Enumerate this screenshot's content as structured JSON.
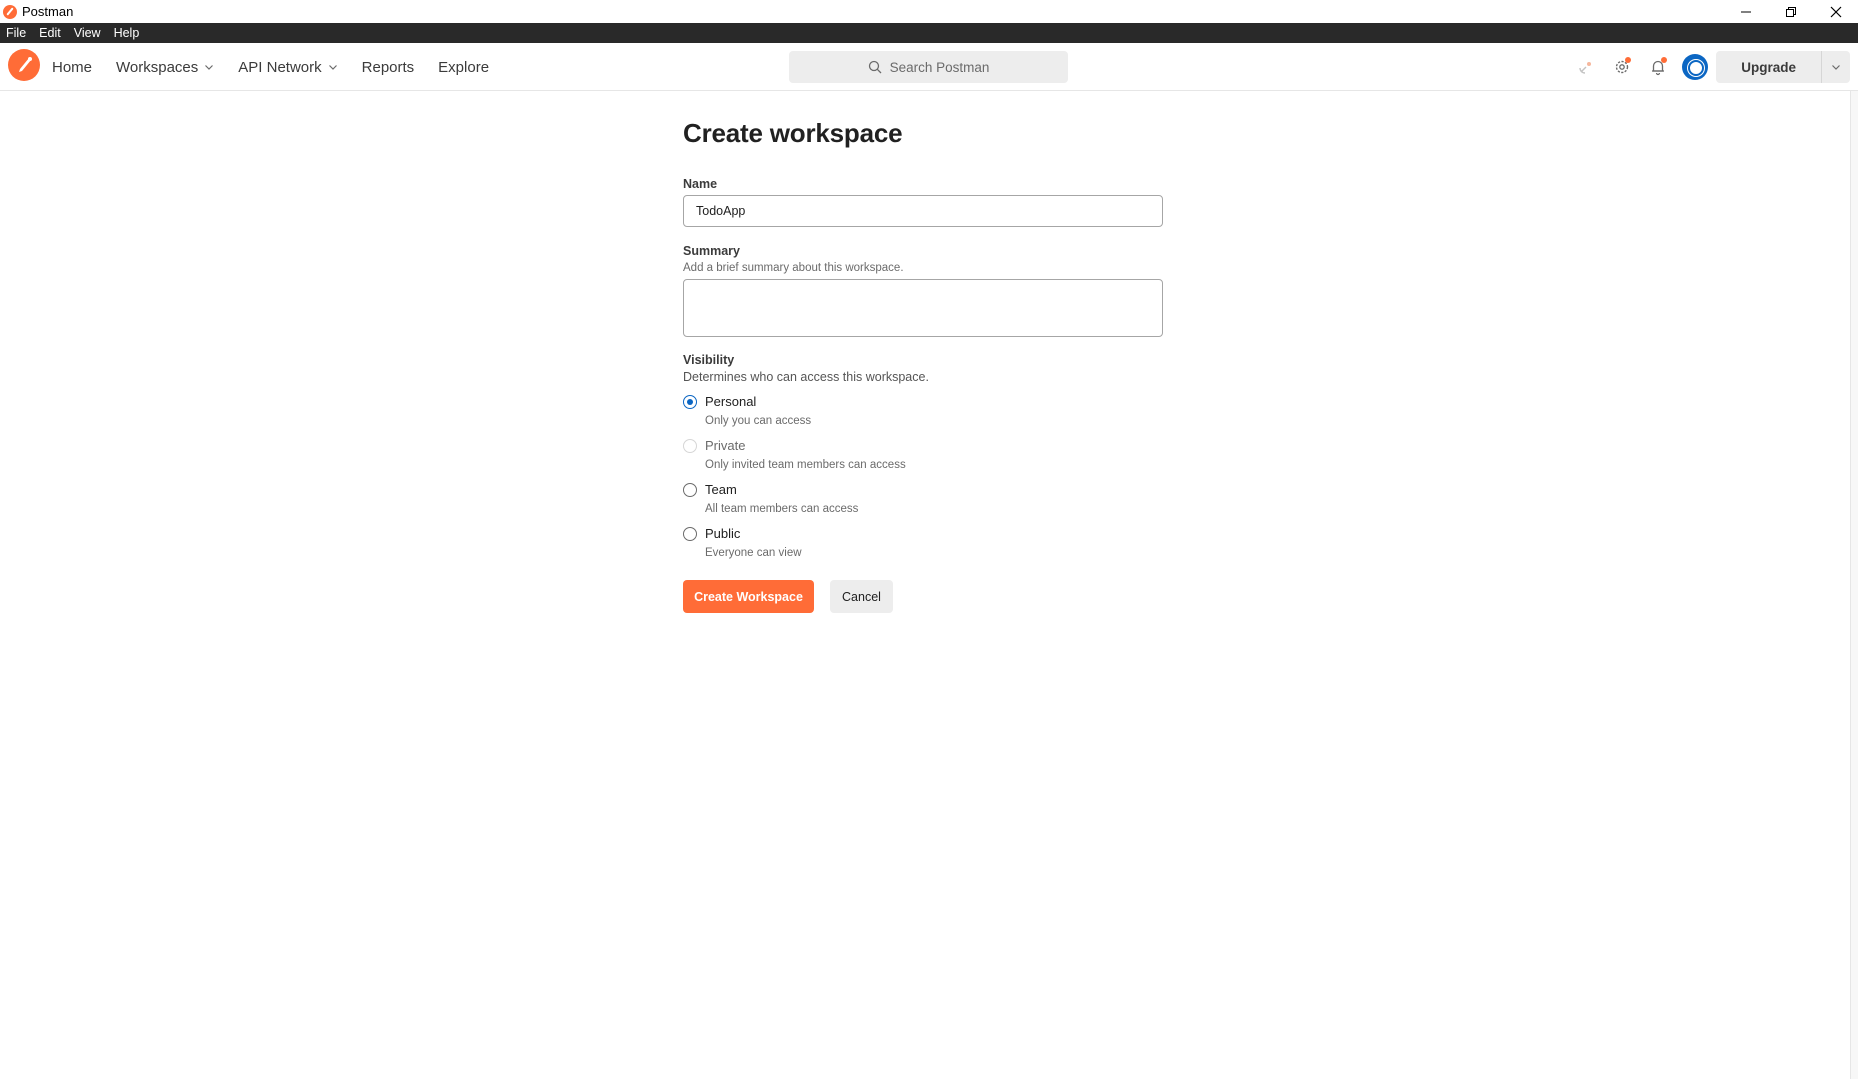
{
  "window": {
    "title": "Postman"
  },
  "menubar": {
    "items": [
      "File",
      "Edit",
      "View",
      "Help"
    ]
  },
  "header": {
    "nav": {
      "home": "Home",
      "workspaces": "Workspaces",
      "api_network": "API Network",
      "reports": "Reports",
      "explore": "Explore"
    },
    "search_placeholder": "Search Postman",
    "upgrade_label": "Upgrade"
  },
  "form": {
    "title": "Create workspace",
    "name_label": "Name",
    "name_value": "TodoApp",
    "summary_label": "Summary",
    "summary_help": "Add a brief summary about this workspace.",
    "summary_value": "",
    "visibility_label": "Visibility",
    "visibility_help": "Determines who can access this workspace.",
    "visibility_options": [
      {
        "title": "Personal",
        "desc": "Only you can access",
        "state": "checked"
      },
      {
        "title": "Private",
        "desc": "Only invited team members can access",
        "state": "disabled"
      },
      {
        "title": "Team",
        "desc": "All team members can access",
        "state": "unchecked"
      },
      {
        "title": "Public",
        "desc": "Everyone can view",
        "state": "unchecked"
      }
    ],
    "create_button": "Create Workspace",
    "cancel_button": "Cancel"
  },
  "colors": {
    "accent": "#ff6c37",
    "radio_selected": "#0b66c3",
    "menubar_bg": "#292929"
  }
}
